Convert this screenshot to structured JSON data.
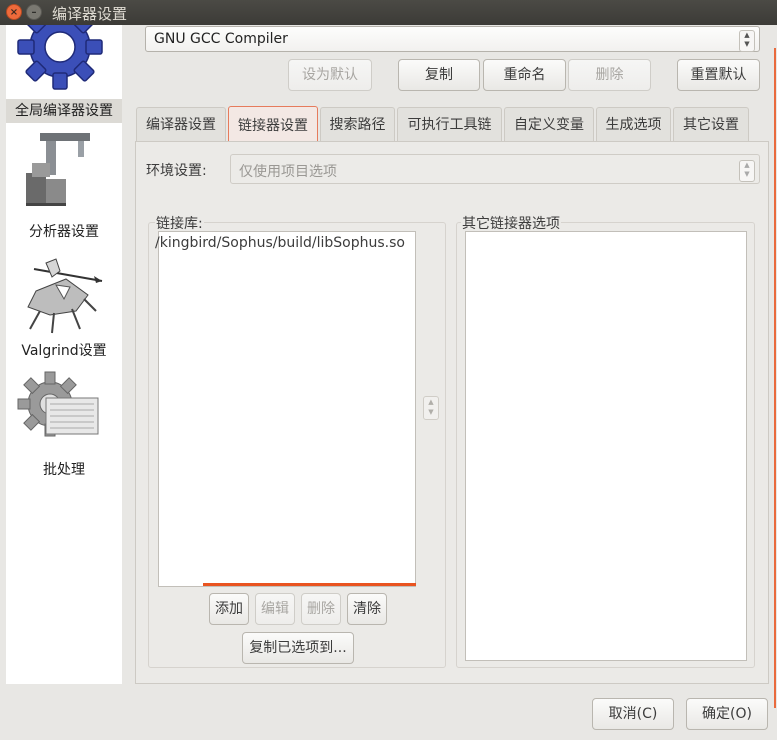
{
  "window": {
    "title": "编译器设置"
  },
  "sidebar": {
    "items": [
      {
        "label": "全局编译器设置",
        "icon": "gear-icon"
      },
      {
        "label": "分析器设置",
        "icon": "profiler-icon"
      },
      {
        "label": "Valgrind设置",
        "icon": "valgrind-knight-icon"
      },
      {
        "label": "批处理",
        "icon": "batch-gear-icon"
      }
    ]
  },
  "compiler": {
    "selected": "GNU GCC Compiler"
  },
  "toolbar": {
    "set_default": "设为默认",
    "copy": "复制",
    "rename": "重命名",
    "delete": "删除",
    "reset_defaults": "重置默认"
  },
  "tabs": [
    "编译器设置",
    "链接器设置",
    "搜索路径",
    "可执行工具链",
    "自定义变量",
    "生成选项",
    "其它设置"
  ],
  "environment": {
    "label": "环境设置:",
    "value": "仅使用项目选项"
  },
  "link_libraries": {
    "label": "链接库:",
    "items": [
      "/kingbird/Sophus/build/libSophus.so"
    ],
    "add": "添加",
    "edit": "编辑",
    "delete": "删除",
    "clear": "清除",
    "copy_selected": "复制已选项到..."
  },
  "other_linker": {
    "label": "其它链接器选项",
    "value": ""
  },
  "dialog": {
    "cancel": "取消(C)",
    "ok": "确定(O)"
  },
  "colors": {
    "accent": "#e95420",
    "title_bg": "#3c3b37"
  }
}
